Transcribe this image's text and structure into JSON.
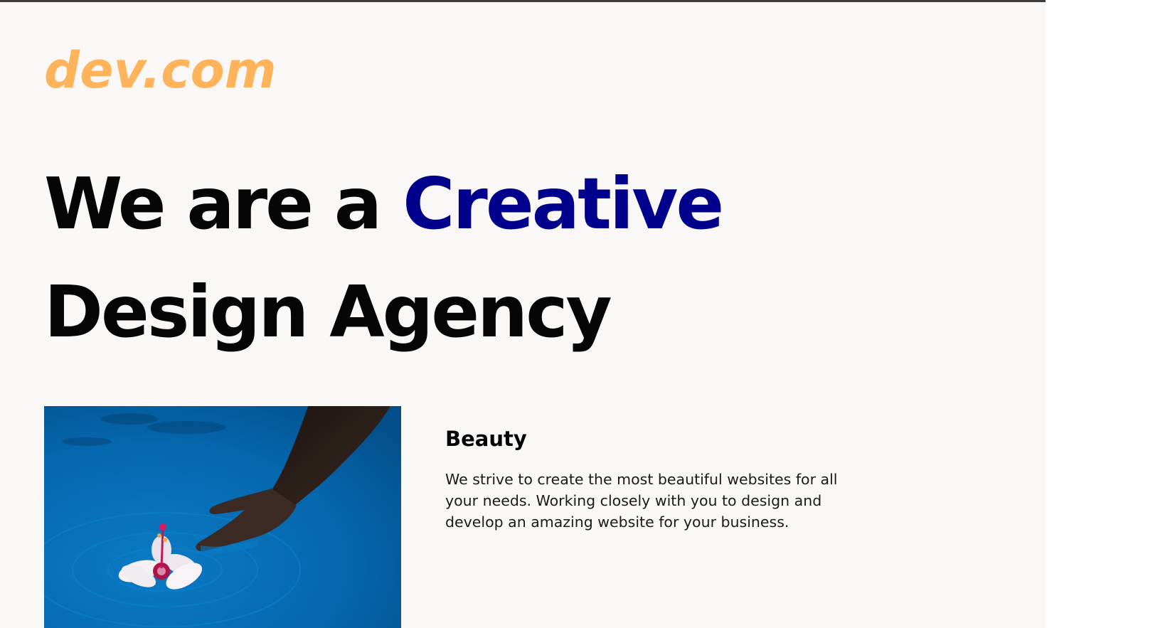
{
  "brand": {
    "logo_text": "dev.com"
  },
  "hero": {
    "title_prefix": "We are a ",
    "title_accent": "Creative",
    "title_line2": "Design Agency"
  },
  "feature": {
    "image_alt": "Hand touching a flower floating on blue water",
    "title": "Beauty",
    "description": "We strive to create the most beautiful websites for all your needs. Working closely with you to design and develop an amazing website for your business."
  },
  "colors": {
    "background": "#f9f8f6",
    "logo": "#ffb45c",
    "accent": "#00008c",
    "text": "#050505"
  }
}
